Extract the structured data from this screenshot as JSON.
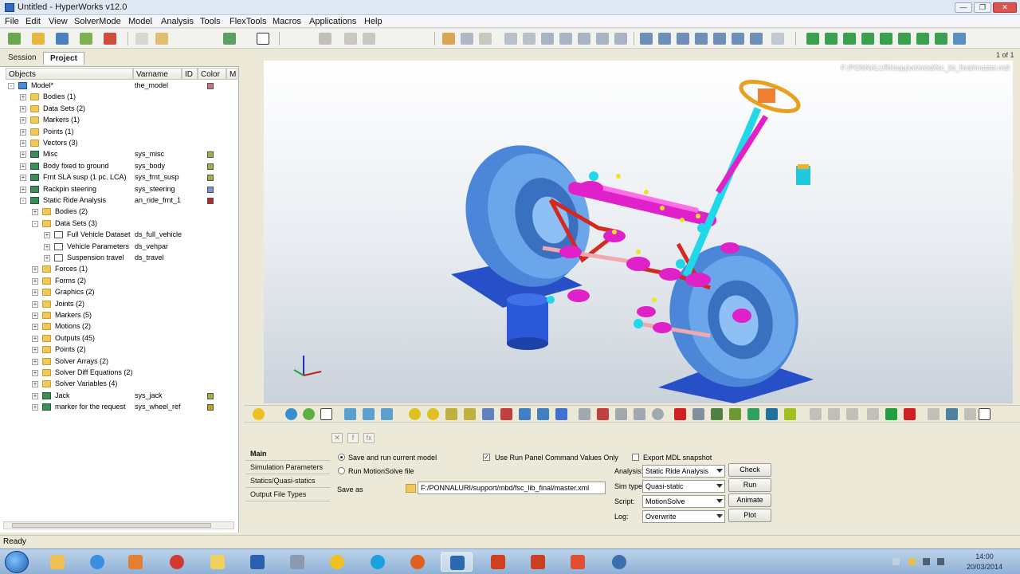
{
  "window": {
    "title": "Untitled - HyperWorks v12.0"
  },
  "menu": [
    "File",
    "Edit",
    "View",
    "SolverMode",
    "Model",
    "Analysis",
    "Tools",
    "FlexTools",
    "Macros",
    "Applications",
    "Help"
  ],
  "browser": {
    "tabs": [
      "Session",
      "Project"
    ],
    "columns": [
      "Objects",
      "Varname",
      "ID",
      "Color",
      "M"
    ],
    "rows": [
      {
        "label": "Model*",
        "var": "the_model",
        "lvl": 0,
        "icon": "model",
        "exp": "-",
        "color": "#d07080"
      },
      {
        "label": "Bodies (1)",
        "var": "",
        "lvl": 1,
        "icon": "folder",
        "exp": "+",
        "color": ""
      },
      {
        "label": "Data Sets (2)",
        "var": "",
        "lvl": 1,
        "icon": "folder",
        "exp": "+",
        "color": ""
      },
      {
        "label": "Markers (1)",
        "var": "",
        "lvl": 1,
        "icon": "folder",
        "exp": "+",
        "color": ""
      },
      {
        "label": "Points (1)",
        "var": "",
        "lvl": 1,
        "icon": "folder",
        "exp": "+",
        "color": ""
      },
      {
        "label": "Vectors (3)",
        "var": "",
        "lvl": 1,
        "icon": "folder",
        "exp": "+",
        "color": ""
      },
      {
        "label": "Misc",
        "var": "sys_misc",
        "lvl": 1,
        "icon": "sys",
        "exp": "+",
        "color": "#a0b040"
      },
      {
        "label": "Body fixed to ground",
        "var": "sys_body",
        "lvl": 1,
        "icon": "sys",
        "exp": "+",
        "color": "#a0b040"
      },
      {
        "label": "Frnt SLA susp (1 pc. LCA)",
        "var": "sys_frnt_susp",
        "lvl": 1,
        "icon": "sys",
        "exp": "+",
        "color": "#a0b040"
      },
      {
        "label": "Rackpin steering",
        "var": "sys_steering",
        "lvl": 1,
        "icon": "sys",
        "exp": "+",
        "color": "#8090d0"
      },
      {
        "label": "Static Ride Analysis",
        "var": "an_ride_frnt_1",
        "lvl": 1,
        "icon": "sys",
        "exp": "-",
        "color": "#c02020"
      },
      {
        "label": "Bodies (2)",
        "var": "",
        "lvl": 2,
        "icon": "folder",
        "exp": "+",
        "color": ""
      },
      {
        "label": "Data Sets (3)",
        "var": "",
        "lvl": 2,
        "icon": "folder",
        "exp": "-",
        "color": ""
      },
      {
        "label": "Full Vehicle Dataset",
        "var": "ds_full_vehicle",
        "lvl": 3,
        "icon": "data",
        "exp": "+",
        "color": ""
      },
      {
        "label": "Vehicle Parameters",
        "var": "ds_vehpar",
        "lvl": 3,
        "icon": "data",
        "exp": "+",
        "color": ""
      },
      {
        "label": "Suspension travel",
        "var": "ds_travel",
        "lvl": 3,
        "icon": "data",
        "exp": "+",
        "color": ""
      },
      {
        "label": "Forces (1)",
        "var": "",
        "lvl": 2,
        "icon": "folder",
        "exp": "+",
        "color": ""
      },
      {
        "label": "Forms (2)",
        "var": "",
        "lvl": 2,
        "icon": "folder",
        "exp": "+",
        "color": ""
      },
      {
        "label": "Graphics (2)",
        "var": "",
        "lvl": 2,
        "icon": "folder",
        "exp": "+",
        "color": ""
      },
      {
        "label": "Joints (2)",
        "var": "",
        "lvl": 2,
        "icon": "folder",
        "exp": "+",
        "color": ""
      },
      {
        "label": "Markers (5)",
        "var": "",
        "lvl": 2,
        "icon": "folder",
        "exp": "+",
        "color": ""
      },
      {
        "label": "Motions (2)",
        "var": "",
        "lvl": 2,
        "icon": "folder",
        "exp": "+",
        "color": ""
      },
      {
        "label": "Outputs (45)",
        "var": "",
        "lvl": 2,
        "icon": "folder",
        "exp": "+",
        "color": ""
      },
      {
        "label": "Points (2)",
        "var": "",
        "lvl": 2,
        "icon": "folder",
        "exp": "+",
        "color": ""
      },
      {
        "label": "Solver Arrays (2)",
        "var": "",
        "lvl": 2,
        "icon": "folder",
        "exp": "+",
        "color": ""
      },
      {
        "label": "Solver Diff Equations (2)",
        "var": "",
        "lvl": 2,
        "icon": "folder",
        "exp": "+",
        "color": ""
      },
      {
        "label": "Solver Variables (4)",
        "var": "",
        "lvl": 2,
        "icon": "folder",
        "exp": "+",
        "color": ""
      },
      {
        "label": "Jack",
        "var": "sys_jack",
        "lvl": 2,
        "icon": "sys",
        "exp": "+",
        "color": "#a0b040"
      },
      {
        "label": "marker for the request",
        "var": "sys_wheel_ref",
        "lvl": 2,
        "icon": "sys",
        "exp": "+",
        "color": "#c0a020"
      }
    ]
  },
  "graphics": {
    "file_path": "F:/PONNALURI/support/mbd/fsc_lib_final/master.mdl",
    "page": "1 of 1"
  },
  "panel": {
    "nav": [
      "Main",
      "Simulation Parameters",
      "Statics/Quasi-statics",
      "Output File Types"
    ],
    "save_and_run": "Save and run current model",
    "run_motionsolve": "Run MotionSolve file",
    "use_run_panel": "Use Run Panel Command Values Only",
    "export_mdl": "Export MDL snapshot",
    "save_as_label": "Save as",
    "save_as_value": "F:/PONNALURI/support/mbd/fsc_lib_final/master.xml",
    "analysis_label": "Analysis:",
    "analysis_value": "Static Ride Analysis",
    "simtype_label": "Sim type:",
    "simtype_value": "Quasi-static",
    "script_label": "Script:",
    "script_value": "MotionSolve",
    "log_label": "Log:",
    "log_value": "Overwrite",
    "buttons": [
      "Check",
      "Run",
      "Animate",
      "Plot"
    ]
  },
  "status": {
    "text": "Ready"
  },
  "taskbar": {
    "time": "14:00",
    "date": "20/03/2014"
  },
  "colors": {
    "graphics_bg_top": "#ffffff",
    "graphics_bg_bottom": "#c9d1d9",
    "wheel": "#5b9be0",
    "magenta": "#e020c8",
    "cyan": "#20d8e8"
  }
}
